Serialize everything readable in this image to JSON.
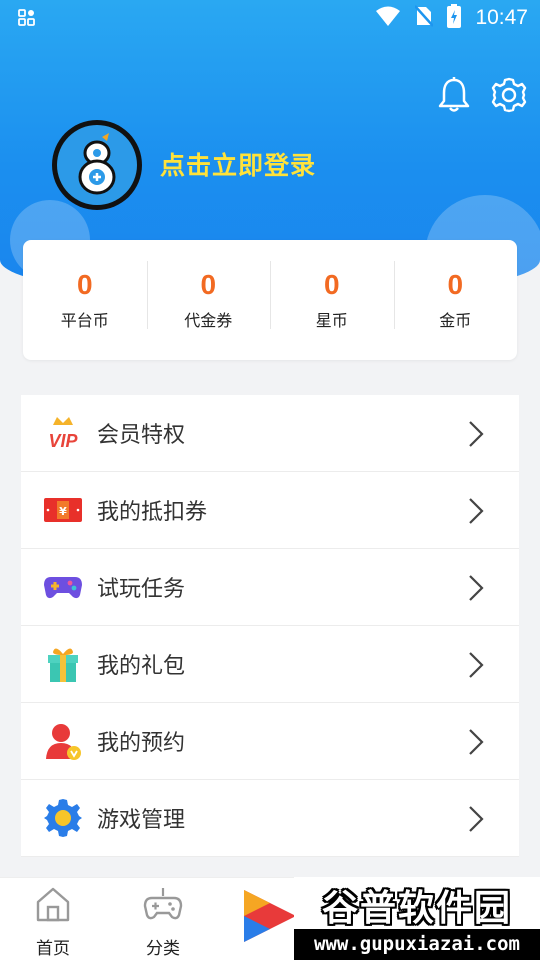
{
  "status_bar": {
    "time": "10:47"
  },
  "profile": {
    "login_prompt": "点击立即登录"
  },
  "stats": [
    {
      "value": "0",
      "label": "平台币"
    },
    {
      "value": "0",
      "label": "代金券"
    },
    {
      "value": "0",
      "label": "星币"
    },
    {
      "value": "0",
      "label": "金币"
    }
  ],
  "menu": [
    {
      "label": "会员特权",
      "icon": "vip-crown-icon"
    },
    {
      "label": "我的抵扣券",
      "icon": "coupon-ticket-icon"
    },
    {
      "label": "试玩任务",
      "icon": "gamepad-icon"
    },
    {
      "label": "我的礼包",
      "icon": "gift-box-icon"
    },
    {
      "label": "我的预约",
      "icon": "reservation-user-icon"
    },
    {
      "label": "游戏管理",
      "icon": "gear-icon"
    }
  ],
  "bottom_nav": [
    {
      "label": "首页",
      "icon": "home-icon"
    },
    {
      "label": "分类",
      "icon": "gamepad-outline-icon"
    },
    {
      "label": "",
      "icon": "play-icon"
    }
  ],
  "watermark": {
    "title": "谷普软件园",
    "url": "www.gupuxiazai.com"
  },
  "colors": {
    "header_blue": "#1a8cef",
    "stat_orange": "#f26a22",
    "login_yellow": "#ffe23a"
  }
}
